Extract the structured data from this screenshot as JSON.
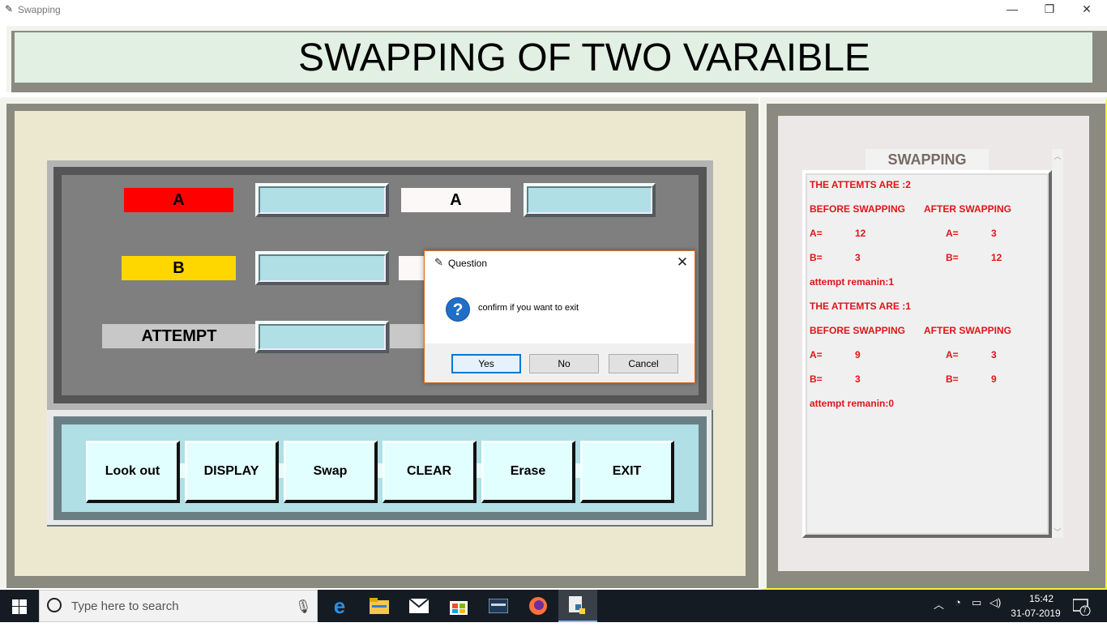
{
  "window": {
    "title": "Swapping",
    "controls": {
      "minimize": "—",
      "restore": "❐",
      "close": "✕"
    }
  },
  "header": {
    "title": "SWAPPING OF TWO VARAIBLE"
  },
  "form": {
    "label_a": "A",
    "label_b": "B",
    "label_a_after": "A",
    "label_attempt": "ATTEMPT",
    "entry_a": "",
    "entry_b": "",
    "entry_attempt": "",
    "entry_a_after": "",
    "colors": {
      "a_label": "#ff0000",
      "b_label": "#ffd700",
      "entry": "#b0dfe5"
    }
  },
  "actions": {
    "buttons": [
      "Look out",
      "DISPLAY",
      "Swap",
      "CLEAR",
      "Erase",
      "EXIT"
    ]
  },
  "log": {
    "title": "SWAPPING",
    "lines": [
      {
        "kind": "single",
        "text": "THE ATTEMTS ARE :2"
      },
      {
        "kind": "pair",
        "left": "BEFORE SWAPPING",
        "right": "AFTER SWAPPING"
      },
      {
        "kind": "vals",
        "l1": "A=",
        "l2": "12",
        "r1": "A=",
        "r2": "3"
      },
      {
        "kind": "vals",
        "l1": "B=",
        "l2": "3",
        "r1": "B=",
        "r2": "12"
      },
      {
        "kind": "single",
        "text": "attempt remanin:1"
      },
      {
        "kind": "single",
        "text": "THE ATTEMTS ARE :1"
      },
      {
        "kind": "pair",
        "left": "BEFORE SWAPPING",
        "right": "AFTER SWAPPING"
      },
      {
        "kind": "vals",
        "l1": "A=",
        "l2": "9",
        "r1": "A=",
        "r2": "3"
      },
      {
        "kind": "vals",
        "l1": "B=",
        "l2": "3",
        "r1": "B=",
        "r2": "9"
      },
      {
        "kind": "single",
        "text": "attempt remanin:0"
      }
    ],
    "text_color": "#e0141a"
  },
  "dialog": {
    "title": "Question",
    "message": "confirm if you want to exit",
    "icon": "?",
    "buttons": {
      "yes": "Yes",
      "no": "No",
      "cancel": "Cancel"
    },
    "close": "✕"
  },
  "taskbar": {
    "search_placeholder": "Type here to search",
    "apps": [
      "edge-icon",
      "file-explorer-icon",
      "mail-icon",
      "store-icon",
      "mysql-icon",
      "firefox-icon",
      "python-icon"
    ],
    "time": "15:42",
    "date": "31-07-2019",
    "notifications": "7"
  }
}
